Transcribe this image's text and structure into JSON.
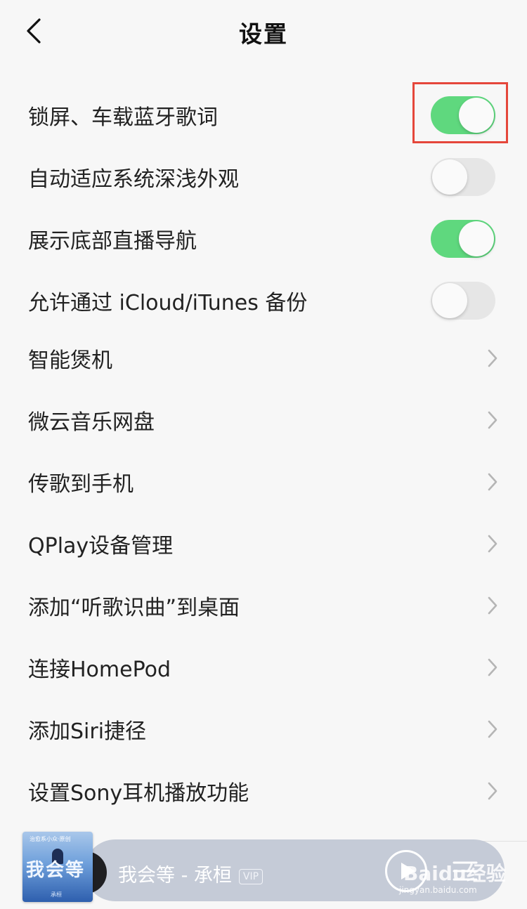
{
  "header": {
    "title": "设置"
  },
  "toggle_rows": [
    {
      "label": "锁屏、车载蓝牙歌词",
      "on": true
    },
    {
      "label": "自动适应系统深浅外观",
      "on": false
    },
    {
      "label": "展示底部直播导航",
      "on": true
    },
    {
      "label": "允许通过 iCloud/iTunes 备份",
      "on": false
    }
  ],
  "link_rows": [
    {
      "label": "智能煲机"
    },
    {
      "label": "微云音乐网盘"
    },
    {
      "label": "传歌到手机"
    },
    {
      "label": "QPlay设备管理"
    },
    {
      "label": "添加“听歌识曲”到桌面"
    },
    {
      "label": "连接HomePod"
    },
    {
      "label": "添加Siri捷径"
    },
    {
      "label": "设置Sony耳机播放功能"
    }
  ],
  "player": {
    "song": "我会等 - 承桓",
    "badge": "VIP",
    "cover_title": "我会等",
    "cover_top": "治愈系小众·原创",
    "cover_bottom": "承桓"
  },
  "watermark": {
    "text": "Baidu经验",
    "sub": "jingyan.baidu.com"
  },
  "colors": {
    "toggle_on": "#5fd87e",
    "toggle_off": "#e6e6e6",
    "highlight": "#e5473b",
    "background": "#f7f7f7"
  }
}
